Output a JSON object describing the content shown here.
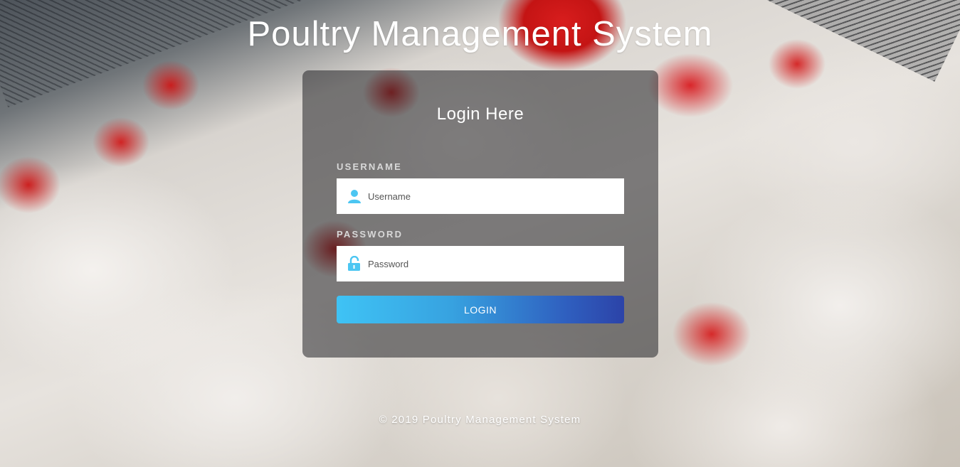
{
  "app": {
    "title": "Poultry Management System"
  },
  "login": {
    "heading": "Login Here",
    "username_label": "USERNAME",
    "username_placeholder": "Username",
    "username_value": "",
    "password_label": "PASSWORD",
    "password_placeholder": "Password",
    "password_value": "",
    "submit_label": "LOGIN"
  },
  "footer": {
    "text": "© 2019 Poultry Management System"
  },
  "icons": {
    "username": "user-icon",
    "password": "unlock-icon"
  },
  "colors": {
    "icon_accent": "#4cc6f2",
    "button_start": "#3fc3f5",
    "button_end": "#2c43a8"
  }
}
